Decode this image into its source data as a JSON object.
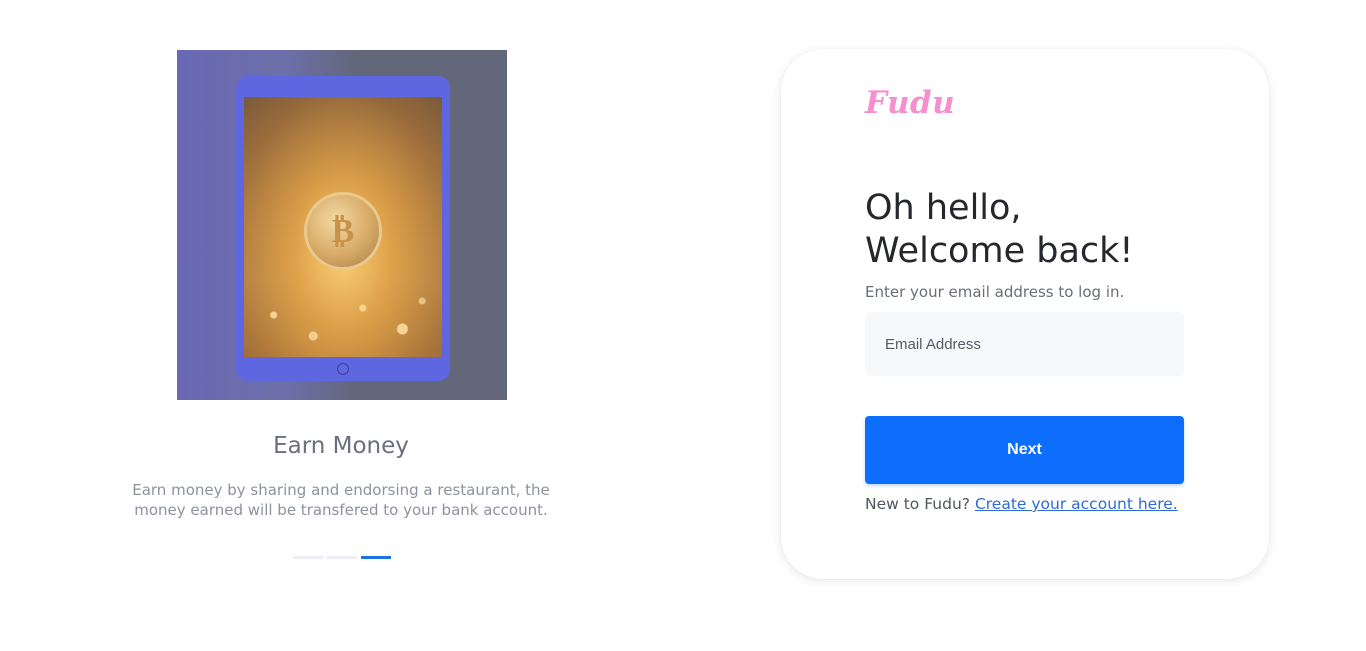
{
  "promo": {
    "title": "Earn Money",
    "description": "Earn money by sharing and endorsing a restaurant, the money earned will be transfered to your bank account.",
    "slides_total": 3,
    "active_slide": 3
  },
  "login": {
    "brand": "Fudu",
    "greeting_line1": "Oh hello,",
    "greeting_line2": "Welcome back!",
    "hint": "Enter your email address to log in.",
    "email_placeholder": "Email Address",
    "email_value": "",
    "next_label": "Next",
    "signup_prompt": "New to Fudu?",
    "signup_link": "Create your account here."
  },
  "colors": {
    "brand": "#f78fcf",
    "primary": "#0d6efd",
    "link": "#2f6ad6",
    "active_dot": "#1a73e8"
  }
}
